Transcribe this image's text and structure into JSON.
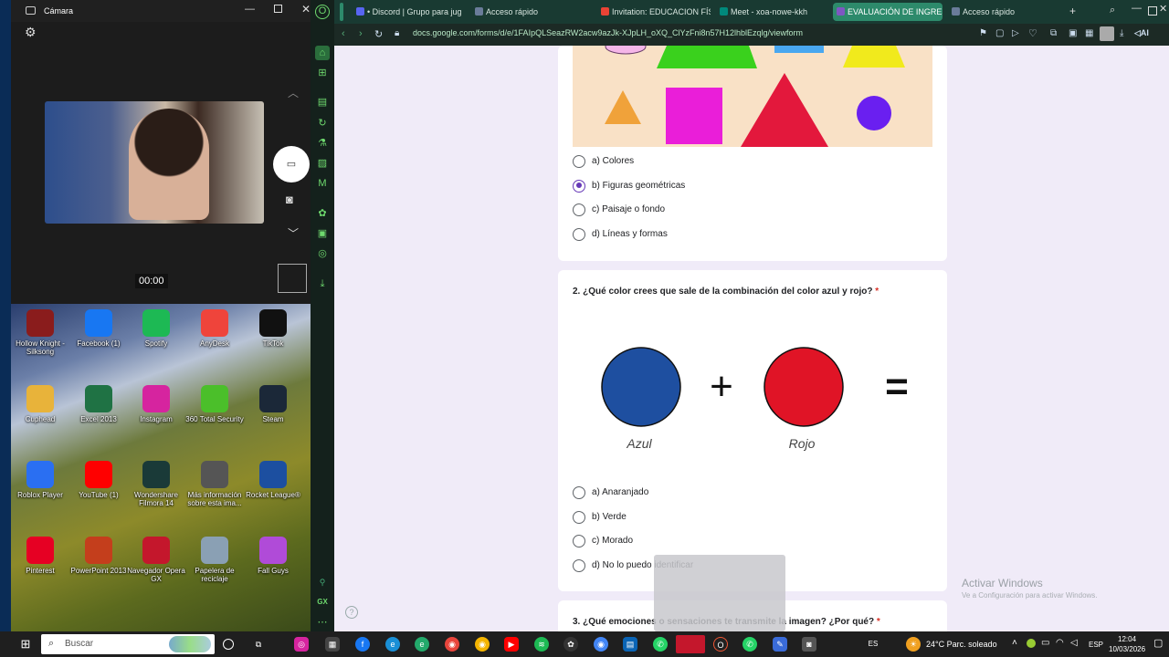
{
  "camera": {
    "title": "Cámara",
    "timer": "00:00"
  },
  "desktop_icons": [
    {
      "label": "Hollow Knight - Silksong",
      "icon": "hollow-knight-icon",
      "color": "#8a1c1c"
    },
    {
      "label": "Facebook (1)",
      "icon": "facebook-icon",
      "color": "#1877f2"
    },
    {
      "label": "Spotify",
      "icon": "spotify-icon",
      "color": "#1db954"
    },
    {
      "label": "AnyDesk",
      "icon": "anydesk-icon",
      "color": "#ef443b"
    },
    {
      "label": "TikTok",
      "icon": "tiktok-icon",
      "color": "#111111"
    },
    {
      "label": "Cuphead",
      "icon": "cuphead-icon",
      "color": "#e8b33a"
    },
    {
      "label": "Excel 2013",
      "icon": "excel-icon",
      "color": "#1f7244"
    },
    {
      "label": "Instagram",
      "icon": "instagram-icon",
      "color": "#d6249f"
    },
    {
      "label": "360 Total Security",
      "icon": "shield-plus-icon",
      "color": "#4bbf2a"
    },
    {
      "label": "Steam",
      "icon": "steam-icon",
      "color": "#1b2838"
    },
    {
      "label": "Roblox Player",
      "icon": "roblox-icon",
      "color": "#2a6ff2"
    },
    {
      "label": "YouTube (1)",
      "icon": "youtube-icon",
      "color": "#ff0000"
    },
    {
      "label": "Wondershare Filmora 14",
      "icon": "filmora-icon",
      "color": "#1a3a38"
    },
    {
      "label": "Más información sobre esta ima...",
      "icon": "info-camera-icon",
      "color": "#555555"
    },
    {
      "label": "Rocket League®",
      "icon": "rocket-league-icon",
      "color": "#1c4fa0"
    },
    {
      "label": "Pinterest",
      "icon": "pinterest-icon",
      "color": "#e60023"
    },
    {
      "label": "PowerPoint 2013",
      "icon": "powerpoint-icon",
      "color": "#c43e1c"
    },
    {
      "label": "Navegador Opera GX",
      "icon": "opera-gx-icon",
      "color": "#c4172c"
    },
    {
      "label": "Papelera de reciclaje",
      "icon": "recycle-bin-icon",
      "color": "#8aa0b4"
    },
    {
      "label": "Fall Guys",
      "icon": "fall-guys-icon",
      "color": "#b04bd8"
    }
  ],
  "browser": {
    "tabs": [
      {
        "label": "• Discord | Grupo para jug",
        "color": "#5865f2"
      },
      {
        "label": "Acceso rápido",
        "color": "#6a7c9a"
      },
      {
        "label": "Invitation: EDUCACION FÍS",
        "color": "#ea4335"
      },
      {
        "label": "Meet - xoa-nowe-kkh",
        "color": "#00897b"
      },
      {
        "label": "EVALUACIÓN DE INGRES",
        "color": "#7e57c2"
      },
      {
        "label": "Acceso rápido",
        "color": "#6a7c9a"
      }
    ],
    "url": "docs.google.com/forms/d/e/1FAIpQLSeazRW2acw9azJk-XJpLH_oXQ_ClYzFni8n57H12lhblEzqlg/viewform"
  },
  "form": {
    "q1_options": [
      "a) Colores",
      "b) Figuras geométricas",
      "c) Paisaje o fondo",
      "d) Líneas y formas"
    ],
    "q1_selected": 1,
    "q2": {
      "number": "2.",
      "text": "¿Qué color crees que sale de la combinación del color azul y rojo?",
      "required": "*",
      "image_labels": {
        "left": "Azul",
        "right": "Rojo"
      },
      "colors": {
        "blue": "#1e4fa0",
        "red": "#e01426"
      },
      "options": [
        "a) Anaranjado",
        "b) Verde",
        "c) Morado",
        "d) No lo puedo identificar"
      ]
    },
    "q3": {
      "number": "3.",
      "text": "¿Qué emociones o sensaciones te transmite la imagen?  ¿Por qué?",
      "required": "*"
    }
  },
  "watermark": {
    "title": "Activar Windows",
    "subtitle": "Ve a Configuración para activar Windows."
  },
  "taskbar": {
    "search_placeholder": "Buscar",
    "weather": "24°C  Parc. soleado",
    "language": "ESP",
    "time": "12:04",
    "date": "10/03/2026"
  }
}
